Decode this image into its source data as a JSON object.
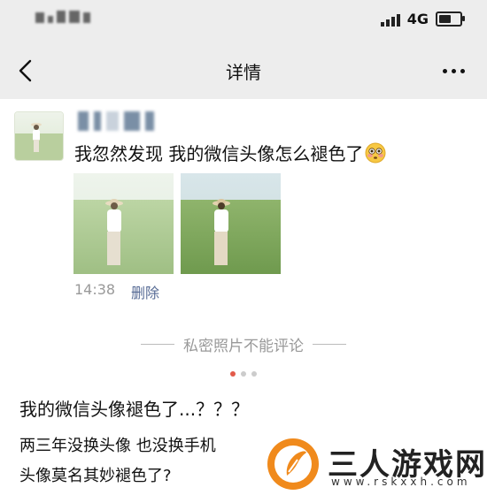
{
  "status_bar": {
    "network": "4G",
    "battery_level": 0.6
  },
  "nav": {
    "title": "详情"
  },
  "post": {
    "text": "我忽然发现 我的微信头像怎么褪色了",
    "time": "14:38",
    "delete_label": "删除"
  },
  "divider": {
    "text": "私密照片不能评论"
  },
  "pager": {
    "count": 3,
    "active_index": 0
  },
  "article": {
    "headline": "我的微信头像褪色了...？？？",
    "line1": "两三年没换头像 也没换手机",
    "line2": "头像莫名其妙褪色了?"
  },
  "watermark": {
    "title": "三人游戏网",
    "url": "www.rskxxh.com"
  },
  "colors": {
    "link": "#576b95",
    "bar_bg": "#ededed",
    "accent": "#e25a4a",
    "logo_orange": "#f08a1c"
  }
}
